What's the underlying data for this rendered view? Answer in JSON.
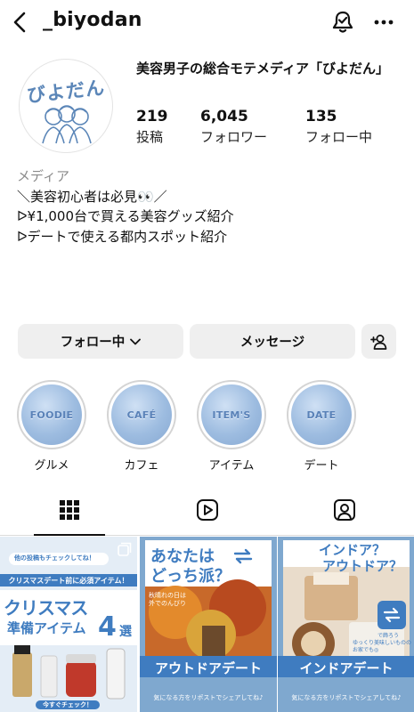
{
  "header": {
    "username": "_biyodan",
    "back_icon": "chevron-left-icon",
    "notify_icon": "bell-check-icon",
    "more_icon": "ellipsis-icon"
  },
  "profile": {
    "avatar_text": "びよだん",
    "display_name": "美容男子の総合モテメディア「びよだん」",
    "stats": [
      {
        "value": "219",
        "label": "投稿"
      },
      {
        "value": "6,045",
        "label": "フォロワー"
      },
      {
        "value": "135",
        "label": "フォロー中"
      }
    ],
    "category": "メディア",
    "bio_lines": [
      "＼美容初心者は必見👀／",
      "ᐅ¥1,000台で買える美容グッズ紹介",
      "ᐅデートで使える都内スポット紹介"
    ]
  },
  "actions": {
    "following_label": "フォロー中",
    "message_label": "メッセージ",
    "add_person_icon": "person-plus-icon"
  },
  "highlights": [
    {
      "cover": "FOODIE",
      "label": "グルメ"
    },
    {
      "cover": "CAFÉ",
      "label": "カフェ"
    },
    {
      "cover": "ITEM'S",
      "label": "アイテム"
    },
    {
      "cover": "DATE",
      "label": "デート"
    }
  ],
  "tabs": [
    {
      "icon": "grid-icon",
      "active": true
    },
    {
      "icon": "reels-icon",
      "active": false
    },
    {
      "icon": "tagged-icon",
      "active": false
    }
  ],
  "posts": [
    {
      "top_note": "他の投稿もチェックしてね！",
      "banner": "クリスマスデート前に必須アイテム！",
      "title_line1": "クリスマス",
      "title_line2": "準備アイテム",
      "count": "4",
      "count_suffix": "選",
      "cta": "今すぐチェック！"
    },
    {
      "headline_line1": "あなたは",
      "headline_line2": "どっち派？",
      "photo_note_line1": "秋晴れの日は",
      "photo_note_line2": "外でのんびり",
      "title": "アウトドアデート",
      "footer": "気になる方をリポストでシェアしてね♪"
    },
    {
      "headline_line1": "インドア？",
      "headline_line2": "アウトドア？",
      "badge": "で飾ろう",
      "photo_note_line1": "ゆっくり美味しいものの",
      "photo_note_line2": "お家でも◎",
      "title": "インドアデート",
      "footer": "気になる方をリポストでシェアしてね♪"
    }
  ],
  "colors": {
    "accent_blue": "#3f7cc0",
    "button_bg": "#efefef"
  }
}
